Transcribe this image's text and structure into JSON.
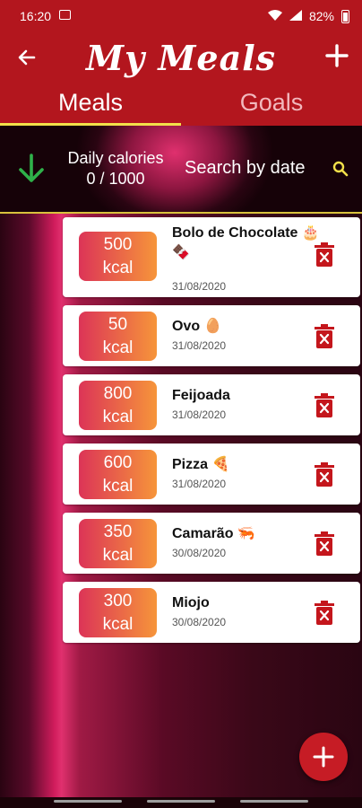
{
  "status_bar": {
    "time": "16:20",
    "battery": "82%"
  },
  "app_bar": {
    "title": "My Meals"
  },
  "tabs": [
    {
      "label": "Meals",
      "active": true
    },
    {
      "label": "Goals",
      "active": false
    }
  ],
  "filter": {
    "daily_label": "Daily calories",
    "daily_value": "0 / 1000",
    "search_label": "Search by date"
  },
  "meals": [
    {
      "kcal": "500",
      "unit": "kcal",
      "name": "Bolo de Chocolate 🎂 🍫",
      "date": "31/08/2020"
    },
    {
      "kcal": "50",
      "unit": "kcal",
      "name": "Ovo 🥚",
      "date": "31/08/2020"
    },
    {
      "kcal": "800",
      "unit": "kcal",
      "name": "Feijoada",
      "date": "31/08/2020"
    },
    {
      "kcal": "600",
      "unit": "kcal",
      "name": "Pizza 🍕",
      "date": "31/08/2020"
    },
    {
      "kcal": "350",
      "unit": "kcal",
      "name": "Camarão 🦐",
      "date": "30/08/2020"
    },
    {
      "kcal": "300",
      "unit": "kcal",
      "name": "Miojo",
      "date": "30/08/2020"
    }
  ],
  "colors": {
    "primary": "#b3161e",
    "accent_yellow": "#f2e04a",
    "down_arrow": "#2fb14a",
    "trash": "#c4161c",
    "kcal_gradient_start": "#dc3457",
    "kcal_gradient_end": "#f6953a"
  }
}
